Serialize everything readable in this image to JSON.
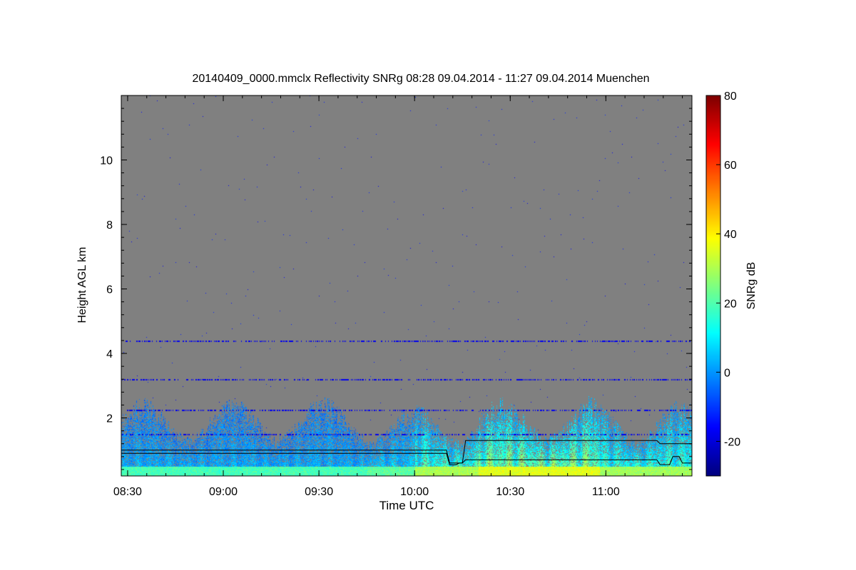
{
  "chart_data": {
    "type": "heatmap",
    "title": "20140409_0000.mmclx Reflectivity SNRg   08:28 09.04.2014 - 11:27 09.04.2014 Muenchen",
    "xlabel": "Time UTC",
    "ylabel": "Height AGL km",
    "xlim": [
      "08:28",
      "11:27"
    ],
    "ylim": [
      0.2,
      12.0
    ],
    "x_ticks": [
      "08:30",
      "09:00",
      "09:30",
      "10:00",
      "10:30",
      "11:00"
    ],
    "y_ticks": [
      2,
      4,
      6,
      8,
      10
    ],
    "missing_color": "#808080",
    "colorbar": {
      "label": "SNRg dB",
      "range": [
        -30,
        80
      ],
      "ticks": [
        -20,
        0,
        20,
        40,
        60,
        80
      ],
      "colormap": "jet"
    },
    "cloud_layers": [
      {
        "start": "08:32",
        "end": "09:44",
        "top_km": 2.7,
        "max_snr": 10
      },
      {
        "start": "09:45",
        "end": "10:00",
        "top_km": 2.4,
        "max_snr": 14
      },
      {
        "start": "10:00",
        "end": "10:20",
        "top_km": 2.5,
        "max_snr": 28
      },
      {
        "start": "10:20",
        "end": "10:58",
        "top_km": 2.7,
        "max_snr": 38
      },
      {
        "start": "10:58",
        "end": "11:27",
        "top_km": 2.6,
        "max_snr": 26
      }
    ],
    "noise_lines_km": [
      4.4,
      3.2,
      2.25,
      1.5
    ],
    "cloud_base_line": {
      "times": [
        "08:28",
        "10:10",
        "10:11",
        "10:15",
        "10:16",
        "11:16",
        "11:17",
        "11:27"
      ],
      "heights_km": [
        1.0,
        1.0,
        0.6,
        0.6,
        1.3,
        1.3,
        1.2,
        1.2
      ]
    },
    "lower_line": {
      "times": [
        "08:28",
        "10:10",
        "10:11",
        "10:13",
        "10:14",
        "10:15",
        "10:16",
        "11:16",
        "11:17",
        "11:20",
        "11:21",
        "11:23",
        "11:24",
        "11:27"
      ],
      "heights_km": [
        0.9,
        0.9,
        0.55,
        0.55,
        0.6,
        0.6,
        0.7,
        0.7,
        0.55,
        0.55,
        0.8,
        0.8,
        0.6,
        0.6
      ]
    }
  }
}
